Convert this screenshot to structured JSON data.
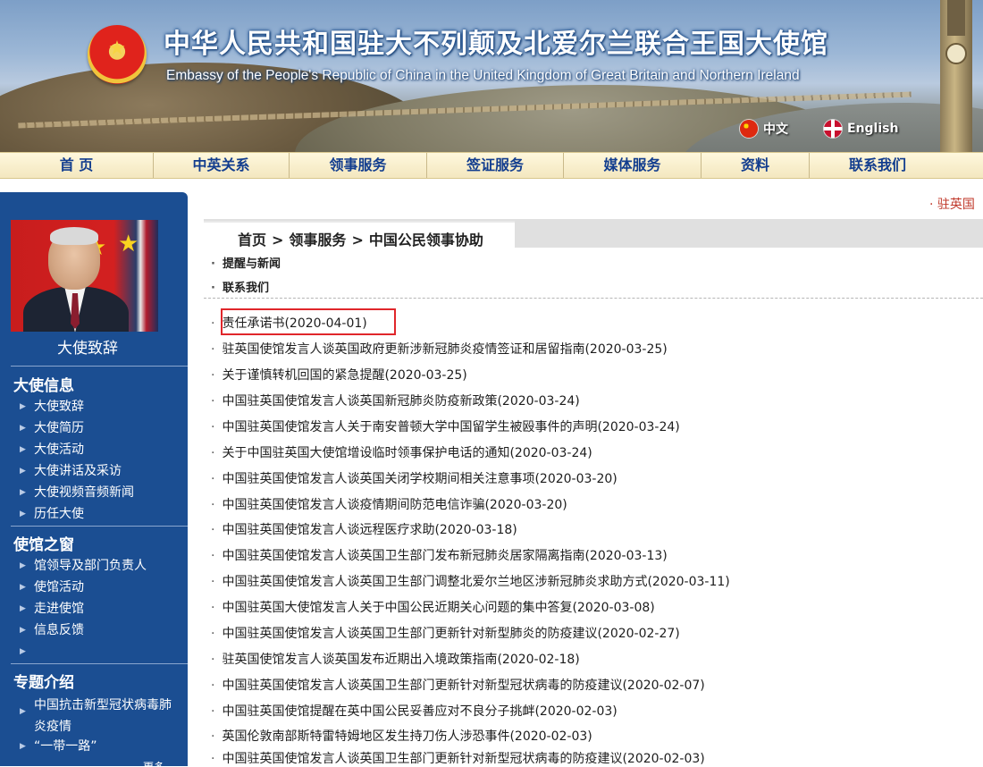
{
  "header": {
    "title": "中华人民共和国驻大不列颠及北爱尔兰联合王国大使馆",
    "subtitle": "Embassy of the People's Republic of China in the United Kingdom of Great Britain and Northern Ireland",
    "lang_cn": "中文",
    "lang_en": "English"
  },
  "nav": {
    "items": [
      "首 页",
      "中英关系",
      "领事服务",
      "签证服务",
      "媒体服务",
      "资料",
      "联系我们"
    ]
  },
  "sidebar": {
    "portrait_caption": "大使致辞",
    "sections": [
      {
        "title": "大使信息",
        "items": [
          "大使致辞",
          "大使简历",
          "大使活动",
          "大使讲话及采访",
          "大使视频音频新闻",
          "历任大使"
        ]
      },
      {
        "title": "使馆之窗",
        "items": [
          "馆领导及部门负责人",
          "使馆活动",
          "走进使馆",
          "信息反馈",
          ""
        ]
      },
      {
        "title": "专题介绍",
        "items": [
          "中国抗击新型冠状病毒肺炎疫情",
          "“一带一路”"
        ]
      }
    ],
    "more": "更多"
  },
  "main": {
    "ticker": "· 驻英国",
    "breadcrumb": [
      "首页",
      "领事服务",
      "中国公民领事协助"
    ],
    "breadcrumb_sep": ">",
    "sub_links": [
      "提醒与新闻",
      "联系我们"
    ],
    "news": [
      "责任承诺书(2020-04-01)",
      "驻英国使馆发言人谈英国政府更新涉新冠肺炎疫情签证和居留指南(2020-03-25)",
      "关于谨慎转机回国的紧急提醒(2020-03-25)",
      "中国驻英国使馆发言人谈英国新冠肺炎防疫新政策(2020-03-24)",
      "中国驻英国使馆发言人关于南安普顿大学中国留学生被殴事件的声明(2020-03-24)",
      "关于中国驻英国大使馆增设临时领事保护电话的通知(2020-03-24)",
      "中国驻英国使馆发言人谈英国关闭学校期间相关注意事项(2020-03-20)",
      "中国驻英国使馆发言人谈疫情期间防范电信诈骗(2020-03-20)",
      "中国驻英国使馆发言人谈远程医疗求助(2020-03-18)",
      "中国驻英国使馆发言人谈英国卫生部门发布新冠肺炎居家隔离指南(2020-03-13)",
      "中国驻英国使馆发言人谈英国卫生部门调整北爱尔兰地区涉新冠肺炎求助方式(2020-03-11)",
      "中国驻英国大使馆发言人关于中国公民近期关心问题的集中答复(2020-03-08)",
      "中国驻英国使馆发言人谈英国卫生部门更新针对新型肺炎的防疫建议(2020-02-27)",
      "驻英国使馆发言人谈英国发布近期出入境政策指南(2020-02-18)",
      "中国驻英国使馆发言人谈英国卫生部门更新针对新型冠状病毒的防疫建议(2020-02-07)",
      "中国驻英国使馆提醒在英中国公民妥善应对不良分子挑衅(2020-02-03)",
      "英国伦敦南部斯特雷特姆地区发生持刀伤人涉恐事件(2020-02-03)",
      "中国驻英国使馆发言人谈英国卫生部门更新针对新型冠状病毒的防疫建议(2020-02-03)"
    ]
  }
}
